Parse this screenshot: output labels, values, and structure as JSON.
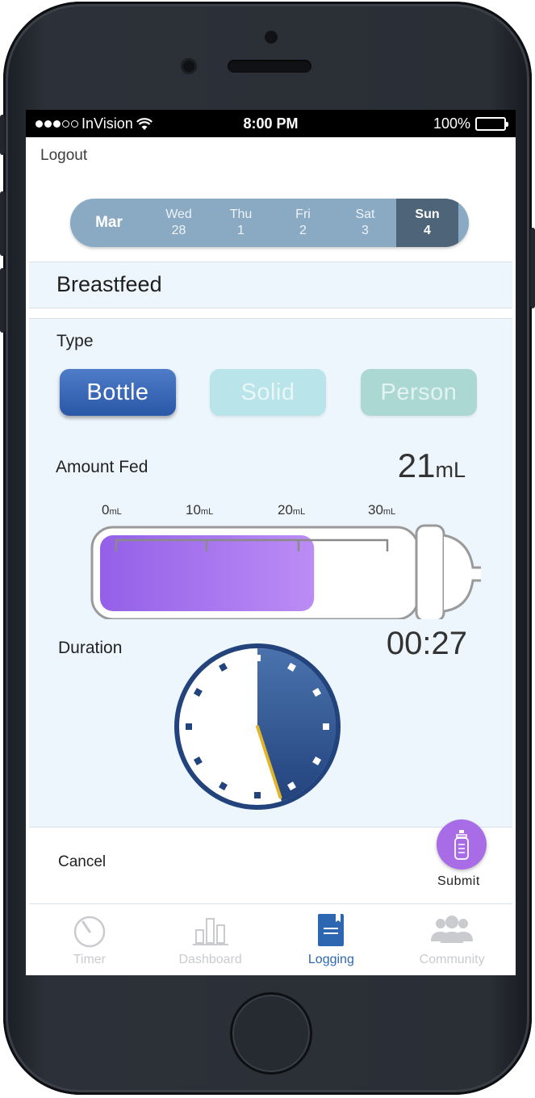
{
  "status_bar": {
    "carrier": "InVision",
    "time": "8:00 PM",
    "battery": "100%"
  },
  "header": {
    "logout_label": "Logout"
  },
  "date_strip": {
    "month": "Mar",
    "days": [
      {
        "weekday": "Wed",
        "date": "28"
      },
      {
        "weekday": "Thu",
        "date": "1"
      },
      {
        "weekday": "Fri",
        "date": "2"
      },
      {
        "weekday": "Sat",
        "date": "3"
      },
      {
        "weekday": "Sun",
        "date": "4",
        "selected": true
      }
    ]
  },
  "page": {
    "title": "Breastfeed"
  },
  "type": {
    "label": "Type",
    "options": [
      "Bottle",
      "Solid",
      "Person"
    ],
    "selected": "Bottle"
  },
  "amount": {
    "label": "Amount Fed",
    "value": "21",
    "unit": "mL",
    "scale": [
      {
        "value": "0",
        "unit": "mL"
      },
      {
        "value": "10",
        "unit": "mL"
      },
      {
        "value": "20",
        "unit": "mL"
      },
      {
        "value": "30",
        "unit": "mL"
      }
    ],
    "fill_ml": 21,
    "max_ml": 30
  },
  "duration": {
    "label": "Duration",
    "value": "00:27",
    "elapsed_fraction": 0.45
  },
  "actions": {
    "cancel_label": "Cancel",
    "submit_label": "Submit"
  },
  "tabs": [
    {
      "label": "Timer",
      "icon": "timer-icon"
    },
    {
      "label": "Dashboard",
      "icon": "bar-chart-icon"
    },
    {
      "label": "Logging",
      "icon": "notebook-icon",
      "active": true
    },
    {
      "label": "Community",
      "icon": "people-icon"
    }
  ],
  "colors": {
    "accent_blue": "#2a58a8",
    "fill_purple": "#a86de6",
    "clock_needle": "#e0b52a",
    "active_tab": "#2d67b2"
  }
}
